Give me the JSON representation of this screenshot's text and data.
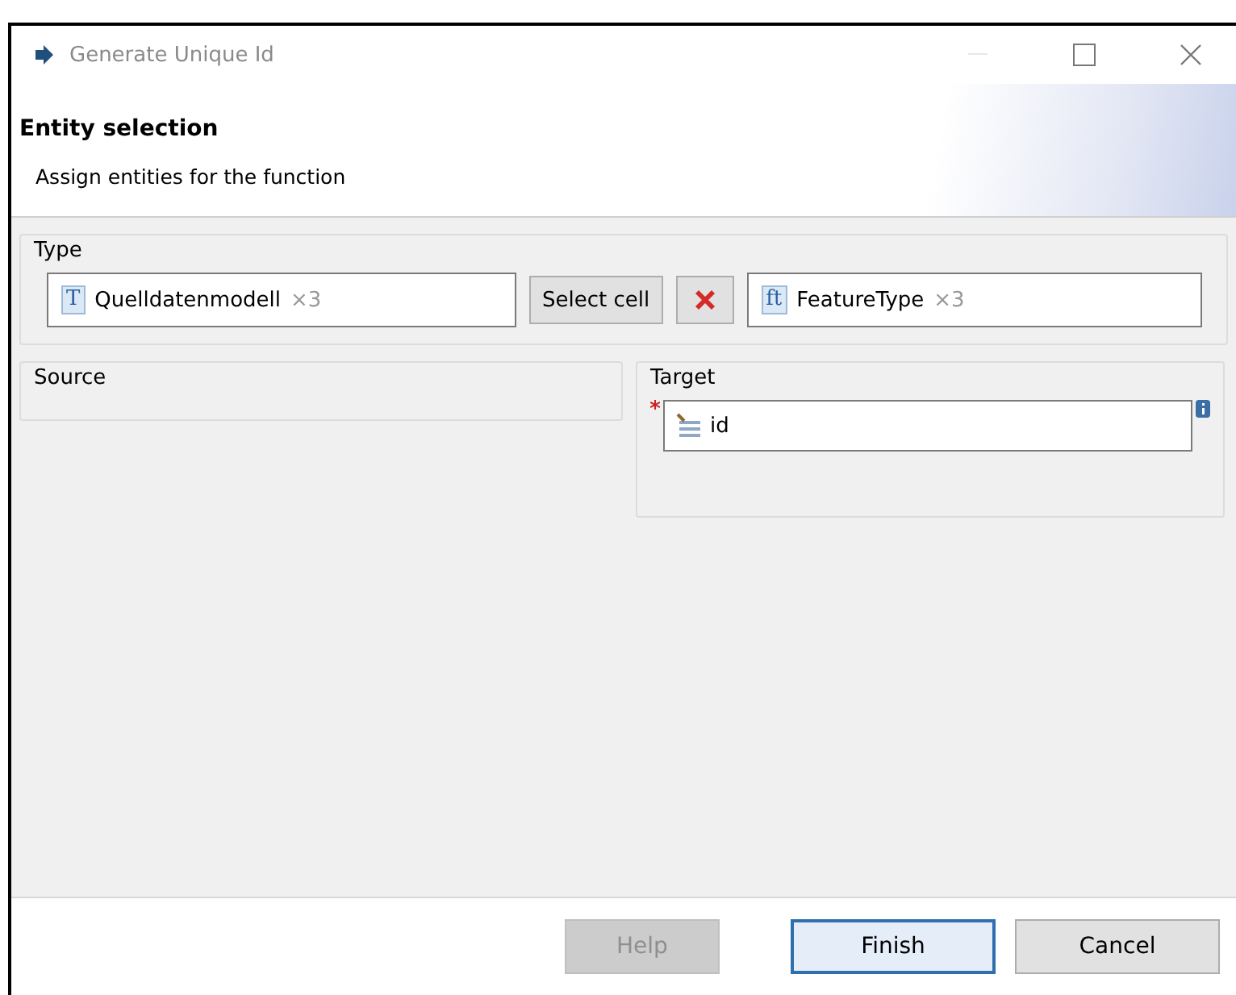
{
  "window": {
    "title": "Generate Unique Id"
  },
  "header": {
    "title": "Entity selection",
    "description": "Assign entities for the function"
  },
  "type_group": {
    "label": "Type",
    "source_entity": {
      "icon": "T",
      "name": "Quelldatenmodell",
      "count": "×3"
    },
    "select_button": "Select cell",
    "target_entity": {
      "icon": "ft",
      "name": "FeatureType",
      "count": "×3"
    }
  },
  "source_group": {
    "label": "Source"
  },
  "target_group": {
    "label": "Target",
    "required": true,
    "field": {
      "value": "id"
    }
  },
  "buttons": [
    {
      "label": "Help",
      "disabled": true,
      "default": false
    },
    {
      "label": "Finish",
      "disabled": false,
      "default": true
    },
    {
      "label": "Cancel",
      "disabled": false,
      "default": false
    }
  ]
}
